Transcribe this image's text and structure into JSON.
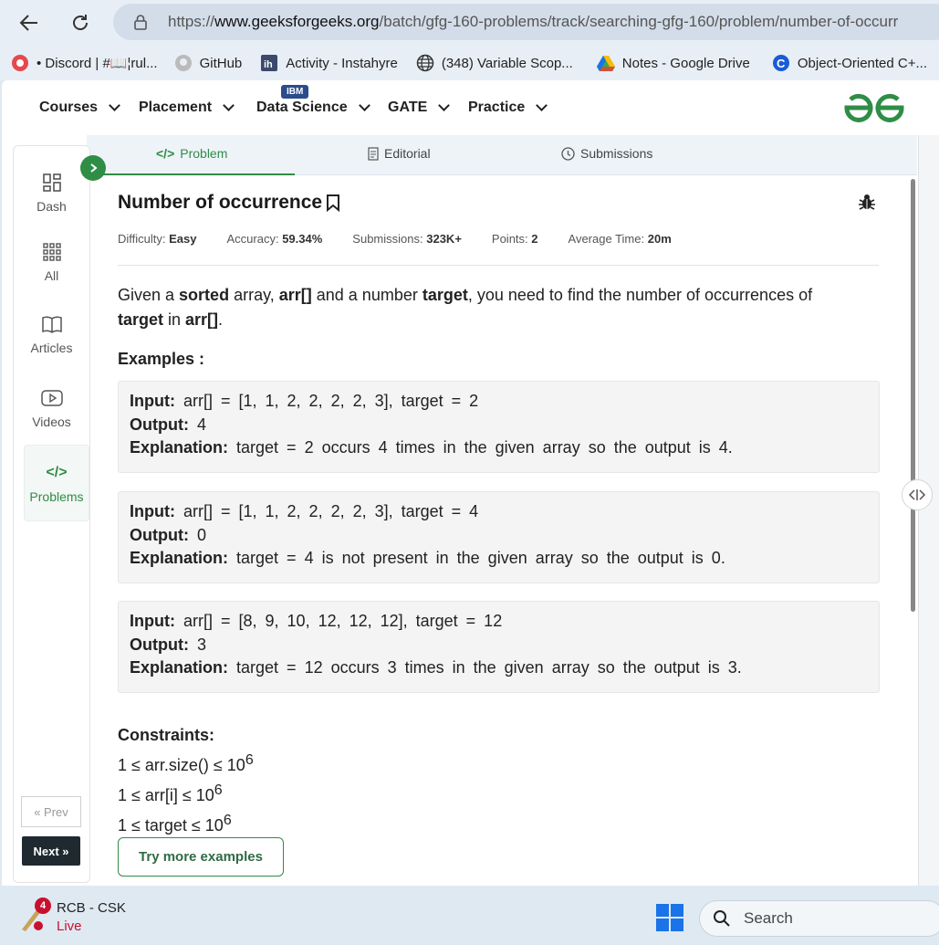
{
  "browser": {
    "url_prefix": "https://",
    "url_domain": "www.geeksforgeeks.org",
    "url_path": "/batch/gfg-160-problems/track/searching-gfg-160/problem/number-of-occurr"
  },
  "bookmarks": [
    {
      "label": "• Discord | #📖¦rul...",
      "icon": "discord-icon"
    },
    {
      "label": "GitHub",
      "icon": "github-icon"
    },
    {
      "label": "Activity - Instahyre",
      "icon": "instahyre-icon"
    },
    {
      "label": "(348) Variable Scop...",
      "icon": "globe-icon"
    },
    {
      "label": "Notes - Google Drive",
      "icon": "google-drive-icon"
    },
    {
      "label": "Object-Oriented C+...",
      "icon": "c-logo-icon"
    }
  ],
  "gfg_nav": {
    "items": [
      "Courses",
      "Placement",
      "Data Science",
      "GATE",
      "Practice"
    ],
    "badge": "IBM"
  },
  "sidebar": {
    "items": [
      "Dash",
      "All",
      "Articles",
      "Videos",
      "Problems"
    ],
    "prev": "Prev",
    "next": "Next"
  },
  "tabs": [
    "Problem",
    "Editorial",
    "Submissions"
  ],
  "problem": {
    "title": "Number of occurrence",
    "meta": [
      {
        "label": "Difficulty:",
        "value": "Easy"
      },
      {
        "label": "Accuracy:",
        "value": "59.34%"
      },
      {
        "label": "Submissions:",
        "value": "323K+"
      },
      {
        "label": "Points:",
        "value": "2"
      },
      {
        "label": "Average Time:",
        "value": "20m"
      }
    ],
    "desc": {
      "p1": "Given a ",
      "b1": "sorted",
      "p2": " array, ",
      "b2": "arr[]",
      "p3": " and a number ",
      "b3": "target",
      "p4": ", you need to find the number of occurrences of ",
      "b4": "target",
      "p5": " in ",
      "b5": "arr[]",
      "p6": "."
    },
    "examples_heading": "Examples :",
    "examples": [
      {
        "input": "arr[] = [1, 1, 2, 2, 2, 2, 3], target = 2",
        "output": "4",
        "explanation": "target = 2 occurs 4 times in the given array so the output is 4."
      },
      {
        "input": "arr[] = [1, 1, 2, 2, 2, 2, 3], target = 4",
        "output": "0",
        "explanation": "target = 4 is not present in the given array so the output is 0."
      },
      {
        "input": "arr[] = [8, 9, 10, 12, 12, 12], target = 12",
        "output": "3",
        "explanation": "target = 12 occurs 3 times in the given array so the output is 3."
      }
    ],
    "labels": {
      "input": "Input:",
      "output": "Output:",
      "explanation": "Explanation:"
    },
    "constraints_heading": "Constraints:",
    "constraints": [
      {
        "text": "1 ≤ arr.size() ≤ 10",
        "exp": "6"
      },
      {
        "text": "1 ≤ arr[i] ≤ 10",
        "exp": "6"
      },
      {
        "text": "1 ≤ target ≤ 10",
        "exp": "6"
      }
    ],
    "try_button": "Try more examples"
  },
  "taskbar": {
    "news_title": "RCB - CSK",
    "news_status": "Live",
    "news_badge": "4",
    "search": "Search"
  },
  "colors": {
    "accent": "#2f8d46",
    "live": "#c8102e"
  }
}
